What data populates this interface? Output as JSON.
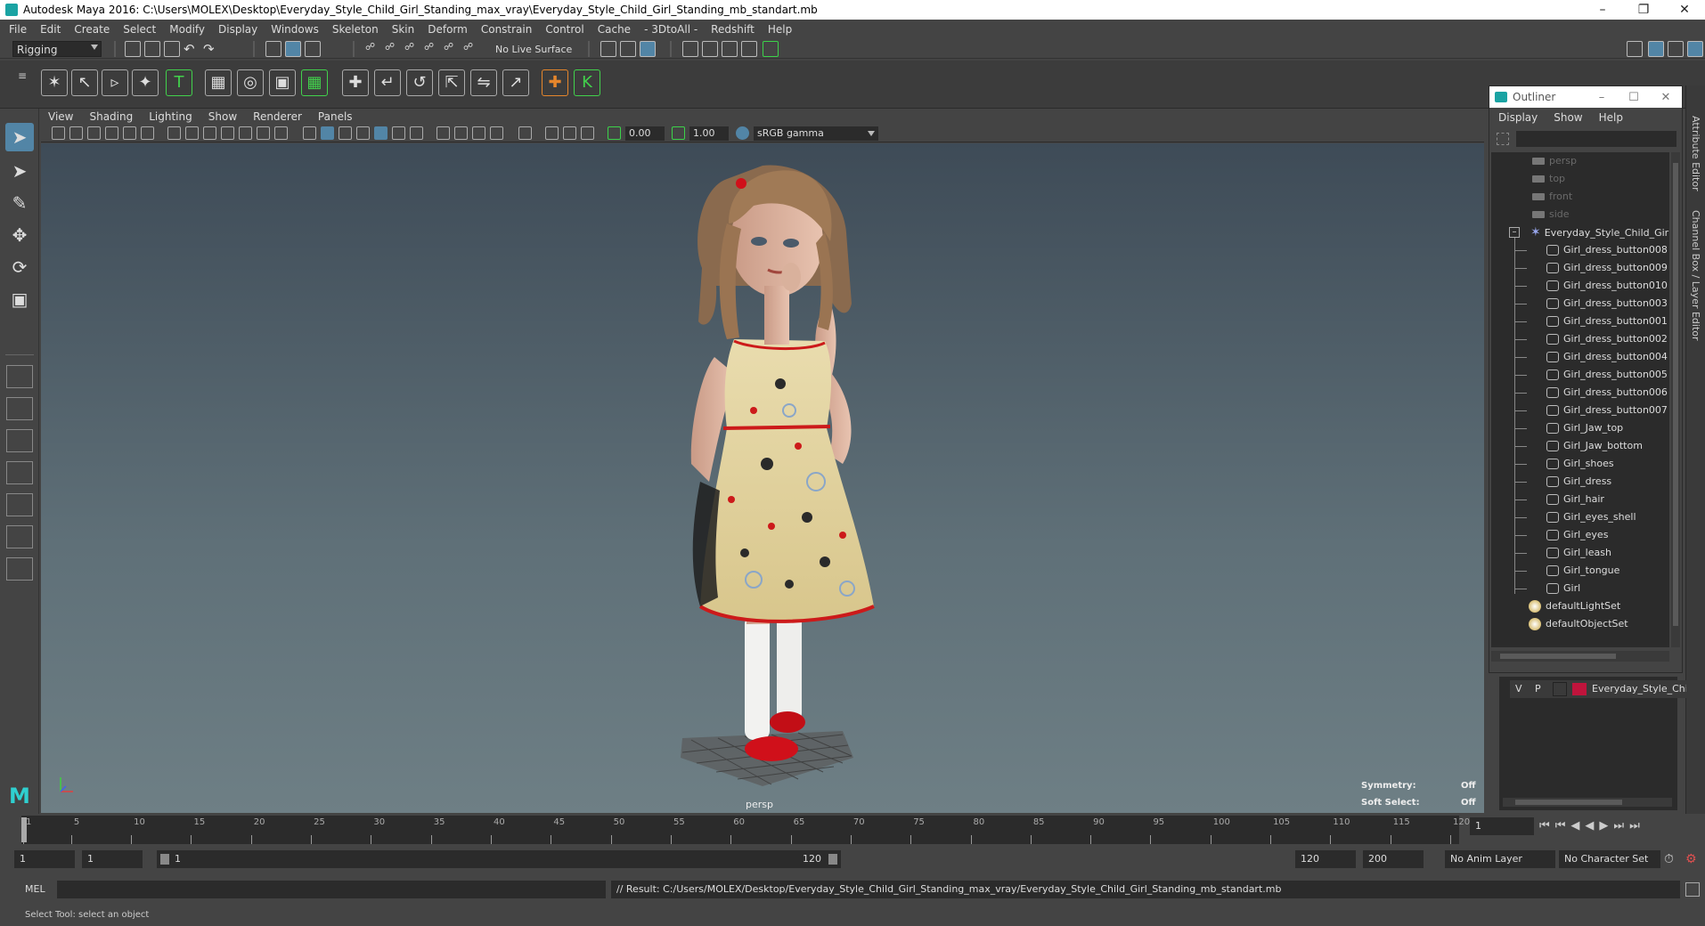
{
  "window": {
    "title": "Autodesk Maya 2016: C:\\Users\\MOLEX\\Desktop\\Everyday_Style_Child_Girl_Standing_max_vray\\Everyday_Style_Child_Girl_Standing_mb_standart.mb"
  },
  "menubar": [
    "File",
    "Edit",
    "Create",
    "Select",
    "Modify",
    "Display",
    "Windows",
    "Skeleton",
    "Skin",
    "Deform",
    "Constrain",
    "Control",
    "Cache",
    "- 3DtoAll -",
    "Redshift",
    "Help"
  ],
  "statusline": {
    "menuset": "Rigging",
    "live_surface": "No Live Surface"
  },
  "viewport": {
    "menu": [
      "View",
      "Shading",
      "Lighting",
      "Show",
      "Renderer",
      "Panels"
    ],
    "exposure": "0.00",
    "gamma": "1.00",
    "colorspace": "sRGB gamma",
    "camera_label": "persp",
    "hud": {
      "symmetry_label": "Symmetry:",
      "symmetry_value": "Off",
      "soft_select_label": "Soft Select:",
      "soft_select_value": "Off"
    }
  },
  "outliner": {
    "title": "Outliner",
    "menu": [
      "Display",
      "Show",
      "Help"
    ],
    "cameras": [
      "persp",
      "top",
      "front",
      "side"
    ],
    "root": "Everyday_Style_Child_Girl_S",
    "children": [
      "Girl_dress_button008",
      "Girl_dress_button009",
      "Girl_dress_button010",
      "Girl_dress_button003",
      "Girl_dress_button001",
      "Girl_dress_button002",
      "Girl_dress_button004",
      "Girl_dress_button005",
      "Girl_dress_button006",
      "Girl_dress_button007",
      "Girl_Jaw_top",
      "Girl_Jaw_bottom",
      "Girl_shoes",
      "Girl_dress",
      "Girl_hair",
      "Girl_eyes_shell",
      "Girl_eyes",
      "Girl_leash",
      "Girl_tongue",
      "Girl"
    ],
    "sets": [
      "defaultLightSet",
      "defaultObjectSet"
    ]
  },
  "side_tabs": [
    "Attribute Editor",
    "Channel Box / Layer Editor"
  ],
  "layer": {
    "v": "V",
    "p": "P",
    "name": "Everyday_Style_Child_G",
    "color": "#c0143c"
  },
  "timeslider": {
    "ticks": [
      "1",
      "5",
      "10",
      "15",
      "20",
      "25",
      "30",
      "35",
      "40",
      "45",
      "50",
      "55",
      "60",
      "65",
      "70",
      "75",
      "80",
      "85",
      "90",
      "95",
      "100",
      "105",
      "110",
      "115",
      "120"
    ],
    "current_frame": "1"
  },
  "range": {
    "start": "1",
    "playback_start": "1",
    "range_start_label": "1",
    "range_end_label": "120",
    "playback_end": "120",
    "end": "200",
    "anim_layer": "No Anim Layer",
    "char_set": "No Character Set"
  },
  "cmdline": {
    "lang": "MEL",
    "result": "// Result: C:/Users/MOLEX/Desktop/Everyday_Style_Child_Girl_Standing_max_vray/Everyday_Style_Child_Girl_Standing_mb_standart.mb"
  },
  "helpline": {
    "text": "Select Tool: select an object"
  }
}
